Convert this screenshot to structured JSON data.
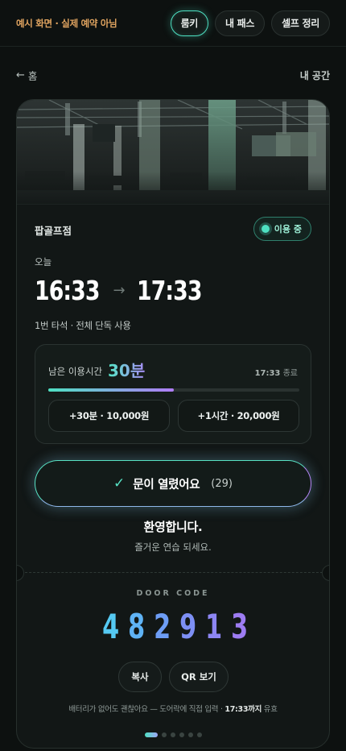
{
  "topbar": {
    "notice": "예시 화면 · 실제 예약 아님",
    "tabs": [
      {
        "label": "룸키",
        "active": true
      },
      {
        "label": "내 패스",
        "active": false
      },
      {
        "label": "셀프 정리",
        "active": false
      }
    ]
  },
  "nav": {
    "back_label": "홈",
    "right_label": "내 공간"
  },
  "booking": {
    "store_name": "팝골프점",
    "status": "이용 중",
    "day_label": "오늘",
    "start_time": "16:33",
    "end_time": "17:33",
    "seat_info": "1번 타석 · 전체 단독 사용",
    "remaining_label": "남은 이용시간",
    "remaining_value": "30분",
    "end_label_time": "17:33",
    "end_label_suffix": "종료",
    "progress_fraction": 0.5,
    "extend_options": [
      "+30분 · 10,000원",
      "+1시간 · 20,000원"
    ]
  },
  "door": {
    "button_label": "문이 열렸어요",
    "countdown": "(29)",
    "welcome_title": "환영합니다.",
    "welcome_sub": "즐거운 연습 되세요."
  },
  "door_code": {
    "label": "DOOR CODE",
    "digits": [
      "4",
      "8",
      "2",
      "9",
      "1",
      "3"
    ],
    "copy_label": "복사",
    "qr_label": "QR 보기",
    "note_prefix": "배터리가 없어도 괜찮아요 — 도어락에 직접 입력 · ",
    "note_time": "17:33까지",
    "note_suffix": " 유효"
  },
  "pager": {
    "count": 6,
    "active_index": 0
  },
  "colors": {
    "accent_teal": "#4ee0c2",
    "accent_purple": "#b07cf6",
    "notice_orange": "#e0a460",
    "background": "#0d1110"
  },
  "icons": {
    "back": "arrow-left-icon",
    "time_arrow": "arrow-right-icon",
    "door_check": "check-icon",
    "status_dot": "status-dot-icon"
  }
}
